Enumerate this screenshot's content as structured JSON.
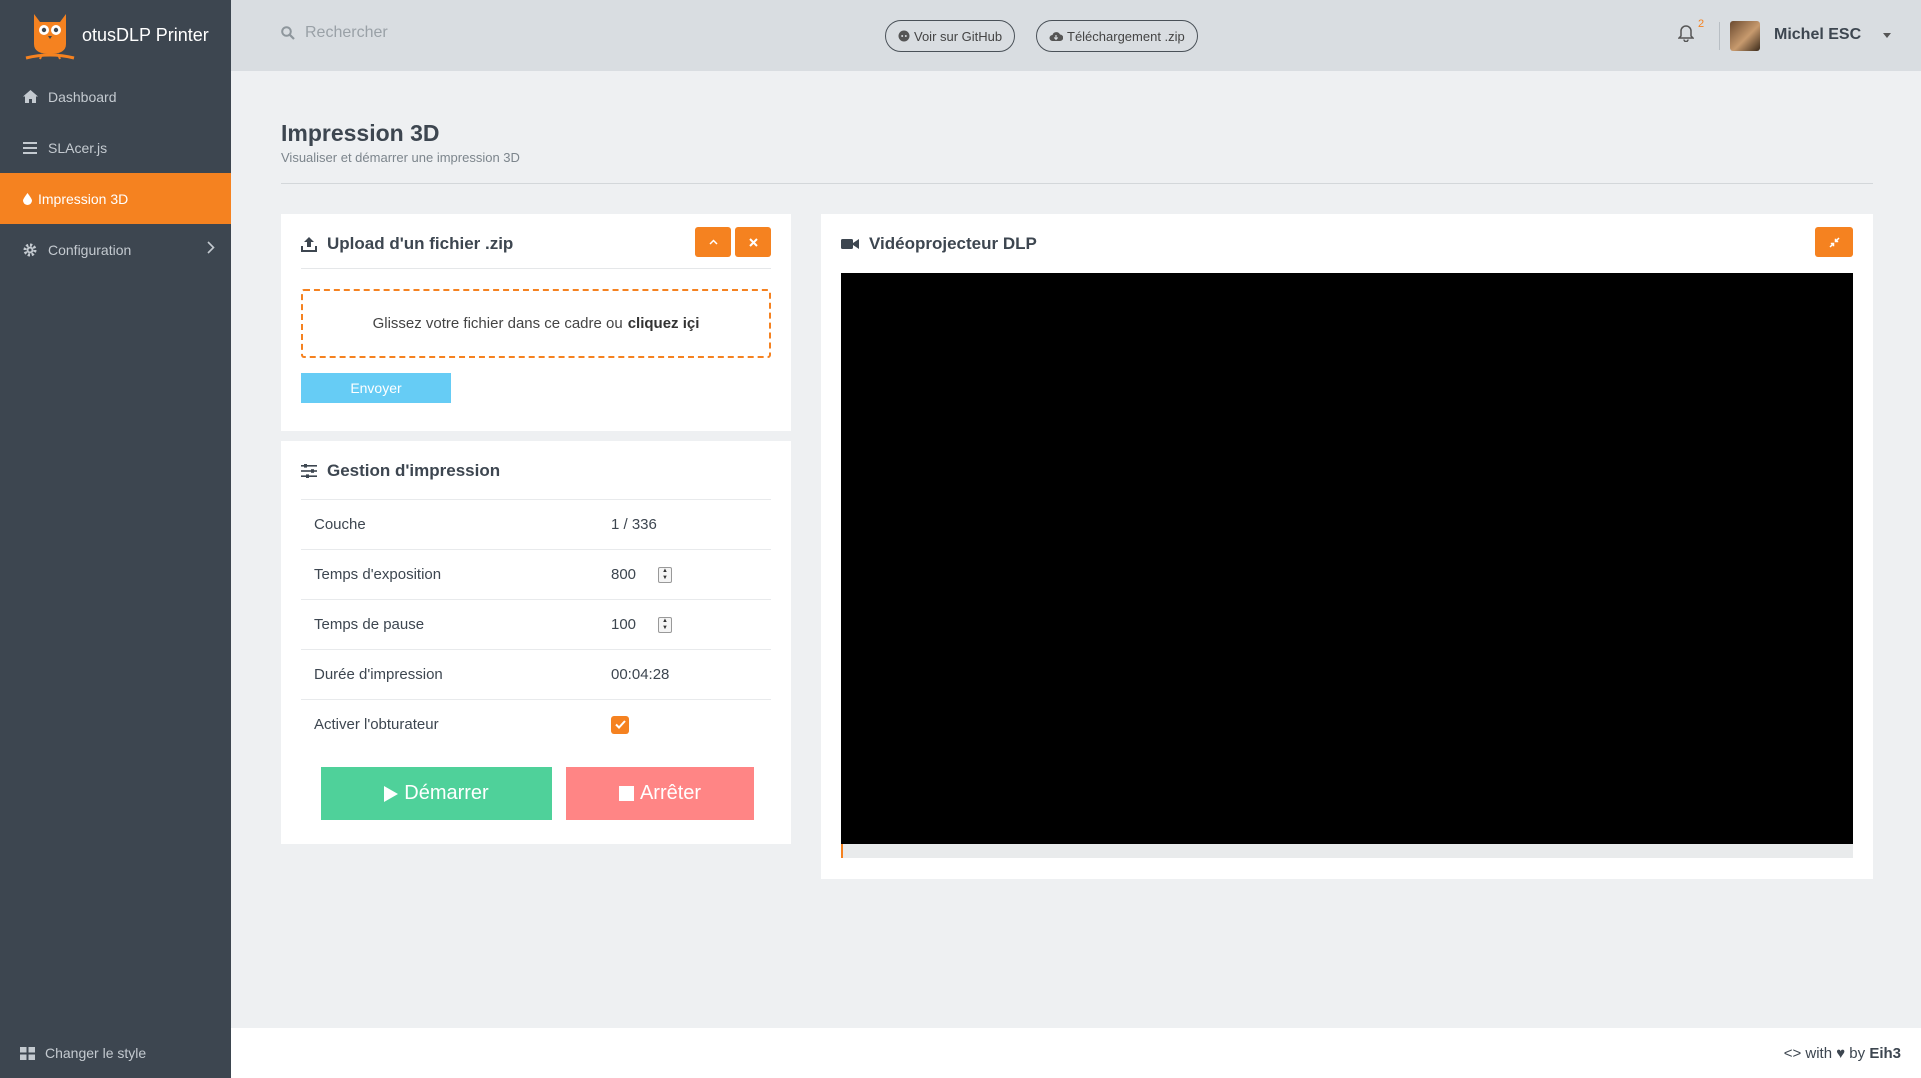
{
  "brand": {
    "name": "otusDLP Printer"
  },
  "sidebar": {
    "items": [
      {
        "label": "Dashboard"
      },
      {
        "label": "SLAcer.js"
      },
      {
        "label": "Impression 3D"
      },
      {
        "label": "Configuration"
      }
    ],
    "footer_label": "Changer le style"
  },
  "topbar": {
    "search_placeholder": "Rechercher",
    "github_label": "Voir sur GitHub",
    "download_label": "Téléchargement .zip",
    "notification_count": "2",
    "user_name": "Michel ESC"
  },
  "page": {
    "title": "Impression 3D",
    "subtitle": "Visualiser et démarrer une impression 3D"
  },
  "upload": {
    "title": "Upload d'un fichier .zip",
    "dropzone_text": "Glissez votre fichier dans ce cadre ou",
    "dropzone_link": "cliquez içi",
    "send_label": "Envoyer"
  },
  "print": {
    "title": "Gestion d'impression",
    "layer_label": "Couche",
    "layer_value": "1 / 336",
    "exposure_label": "Temps d'exposition",
    "exposure_value": "800",
    "pause_label": "Temps de pause",
    "pause_value": "100",
    "duration_label": "Durée d'impression",
    "duration_value": "00:04:28",
    "shutter_label": "Activer l'obturateur",
    "shutter_enabled": true,
    "start_label": "Démarrer",
    "stop_label": "Arrêter"
  },
  "projector": {
    "title": "Vidéoprojecteur DLP",
    "progress_fraction": 0.002
  },
  "footer": {
    "prefix": "<> with ♥ by",
    "author": "Eih3"
  },
  "colors": {
    "accent": "#f58220",
    "sidebar": "#3d4650",
    "start": "#4fd19a",
    "stop": "#ff8585",
    "send": "#66ccf5"
  }
}
